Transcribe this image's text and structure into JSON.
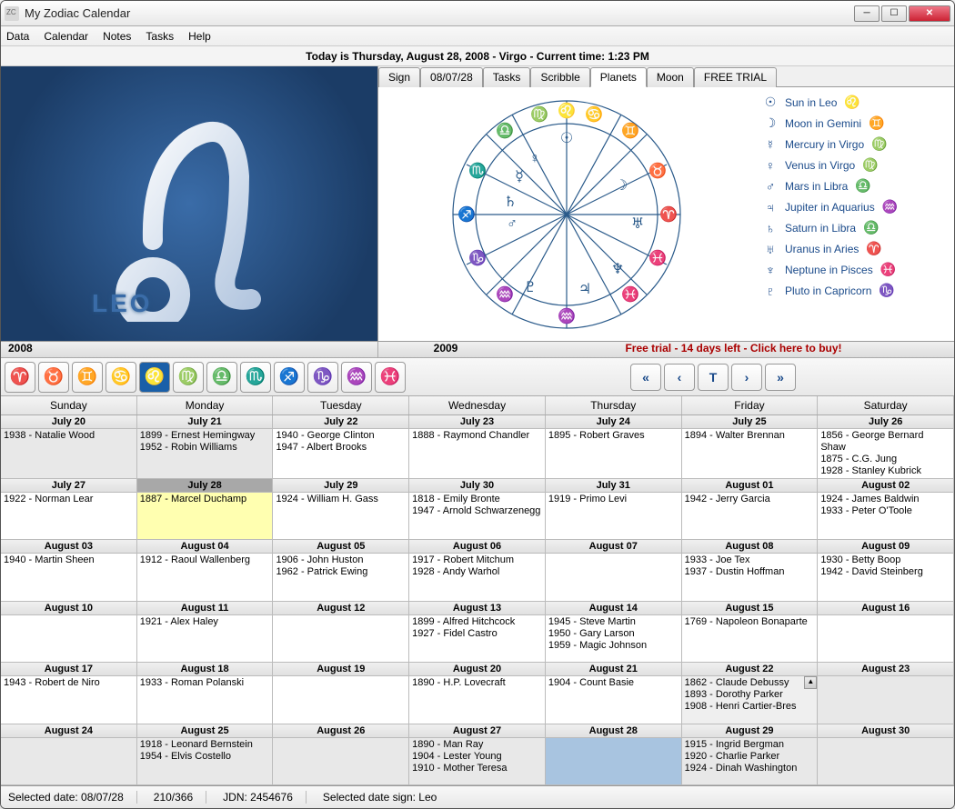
{
  "window_title": "My Zodiac Calendar",
  "menu": [
    "Data",
    "Calendar",
    "Notes",
    "Tasks",
    "Help"
  ],
  "today_bar": "Today is Thursday, August 28, 2008 - Virgo - Current time: 1:23 PM",
  "sign_label": "LEO",
  "tabs": [
    "Sign",
    "08/07/28",
    "Tasks",
    "Scribble",
    "Planets",
    "Moon",
    "FREE TRIAL"
  ],
  "active_tab": 4,
  "planets": [
    {
      "pg": "☉",
      "text": "Sun in Leo",
      "sg": "♌"
    },
    {
      "pg": "☽",
      "text": "Moon in Gemini",
      "sg": "♊"
    },
    {
      "pg": "☿",
      "text": "Mercury in Virgo",
      "sg": "♍"
    },
    {
      "pg": "♀",
      "text": "Venus in Virgo",
      "sg": "♍"
    },
    {
      "pg": "♂",
      "text": "Mars in Libra",
      "sg": "♎"
    },
    {
      "pg": "♃",
      "text": "Jupiter in Aquarius",
      "sg": "♒"
    },
    {
      "pg": "♄",
      "text": "Saturn in Libra",
      "sg": "♎"
    },
    {
      "pg": "♅",
      "text": "Uranus in Aries",
      "sg": "♈"
    },
    {
      "pg": "♆",
      "text": "Neptune in Pisces",
      "sg": "♓"
    },
    {
      "pg": "♇",
      "text": "Pluto in Capricorn",
      "sg": "♑"
    }
  ],
  "year1": "2008",
  "year2": "2009",
  "trial": "Free trial - 14 days left - Click here to buy!",
  "zodiac_btns": [
    "♈",
    "♉",
    "♊",
    "♋",
    "♌",
    "♍",
    "♎",
    "♏",
    "♐",
    "♑",
    "♒",
    "♓"
  ],
  "active_zodiac": 4,
  "nav": [
    "«",
    "‹",
    "T",
    "›",
    "»"
  ],
  "dayheads": [
    "Sunday",
    "Monday",
    "Tuesday",
    "Wednesday",
    "Thursday",
    "Friday",
    "Saturday"
  ],
  "weeks": [
    [
      {
        "d": "July 20",
        "e": [
          "1938 - Natalie Wood"
        ],
        "bg": "gray"
      },
      {
        "d": "July 21",
        "e": [
          "1899 - Ernest Hemingway",
          "1952 - Robin Williams"
        ],
        "bg": "gray"
      },
      {
        "d": "July 22",
        "e": [
          "1940 - George Clinton",
          "1947 - Albert Brooks"
        ]
      },
      {
        "d": "July 23",
        "e": [
          "1888 - Raymond Chandler"
        ]
      },
      {
        "d": "July 24",
        "e": [
          "1895 - Robert Graves"
        ]
      },
      {
        "d": "July 25",
        "e": [
          "1894 - Walter Brennan"
        ]
      },
      {
        "d": "July 26",
        "e": [
          "1856 - George Bernard Shaw",
          "1875 - C.G. Jung",
          "1928 - Stanley Kubrick"
        ]
      }
    ],
    [
      {
        "d": "July 27",
        "e": [
          "1922 - Norman Lear"
        ]
      },
      {
        "d": "July 28",
        "e": [
          "1887 - Marcel Duchamp"
        ],
        "bg": "yellow",
        "sel": true
      },
      {
        "d": "July 29",
        "e": [
          "1924 - William H. Gass"
        ]
      },
      {
        "d": "July 30",
        "e": [
          "1818 - Emily Bronte",
          "1947 - Arnold Schwarzenegg"
        ]
      },
      {
        "d": "July 31",
        "e": [
          "1919 - Primo Levi"
        ]
      },
      {
        "d": "August 01",
        "e": [
          "1942 - Jerry Garcia"
        ]
      },
      {
        "d": "August 02",
        "e": [
          "1924 - James Baldwin",
          "1933 - Peter O'Toole"
        ]
      }
    ],
    [
      {
        "d": "August 03",
        "e": [
          "1940 - Martin Sheen"
        ]
      },
      {
        "d": "August 04",
        "e": [
          "1912 - Raoul Wallenberg"
        ]
      },
      {
        "d": "August 05",
        "e": [
          "1906 - John Huston",
          "1962 - Patrick Ewing"
        ]
      },
      {
        "d": "August 06",
        "e": [
          "1917 - Robert Mitchum",
          "1928 - Andy Warhol"
        ]
      },
      {
        "d": "August 07",
        "e": []
      },
      {
        "d": "August 08",
        "e": [
          "1933 - Joe Tex",
          "1937 - Dustin Hoffman"
        ]
      },
      {
        "d": "August 09",
        "e": [
          "1930 - Betty Boop",
          "1942 - David Steinberg"
        ]
      }
    ],
    [
      {
        "d": "August 10",
        "e": []
      },
      {
        "d": "August 11",
        "e": [
          "1921 - Alex Haley"
        ]
      },
      {
        "d": "August 12",
        "e": []
      },
      {
        "d": "August 13",
        "e": [
          "1899 - Alfred Hitchcock",
          "1927 - Fidel Castro"
        ]
      },
      {
        "d": "August 14",
        "e": [
          "1945 - Steve Martin",
          "1950 - Gary Larson",
          "1959 - Magic Johnson"
        ]
      },
      {
        "d": "August 15",
        "e": [
          "1769 - Napoleon Bonaparte"
        ]
      },
      {
        "d": "August 16",
        "e": []
      }
    ],
    [
      {
        "d": "August 17",
        "e": [
          "1943 - Robert de Niro"
        ]
      },
      {
        "d": "August 18",
        "e": [
          "1933 - Roman Polanski"
        ]
      },
      {
        "d": "August 19",
        "e": []
      },
      {
        "d": "August 20",
        "e": [
          "1890 - H.P. Lovecraft"
        ]
      },
      {
        "d": "August 21",
        "e": [
          "1904 - Count Basie"
        ]
      },
      {
        "d": "August 22",
        "e": [
          "1862 - Claude Debussy",
          "1893 - Dorothy Parker",
          "1908 - Henri Cartier-Bres"
        ],
        "bg": "lightgray",
        "scroll": true
      },
      {
        "d": "August 23",
        "e": [],
        "bg": "gray"
      }
    ],
    [
      {
        "d": "August 24",
        "e": [],
        "bg": "gray"
      },
      {
        "d": "August 25",
        "e": [
          "1918 - Leonard Bernstein",
          "1954 - Elvis Costello"
        ],
        "bg": "gray"
      },
      {
        "d": "August 26",
        "e": [],
        "bg": "gray"
      },
      {
        "d": "August 27",
        "e": [
          "1890 - Man Ray",
          "1904 - Lester Young",
          "1910 - Mother Teresa"
        ],
        "bg": "gray"
      },
      {
        "d": "August 28",
        "e": [],
        "bg": "blue"
      },
      {
        "d": "August 29",
        "e": [
          "1915 - Ingrid Bergman",
          "1920 - Charlie Parker",
          "1924 - Dinah Washington"
        ],
        "bg": "gray"
      },
      {
        "d": "August 30",
        "e": [],
        "bg": "gray"
      }
    ]
  ],
  "status": {
    "sel": "Selected date: 08/07/28",
    "doy": "210/366",
    "jdn": "JDN: 2454676",
    "sign": "Selected date sign: Leo"
  }
}
